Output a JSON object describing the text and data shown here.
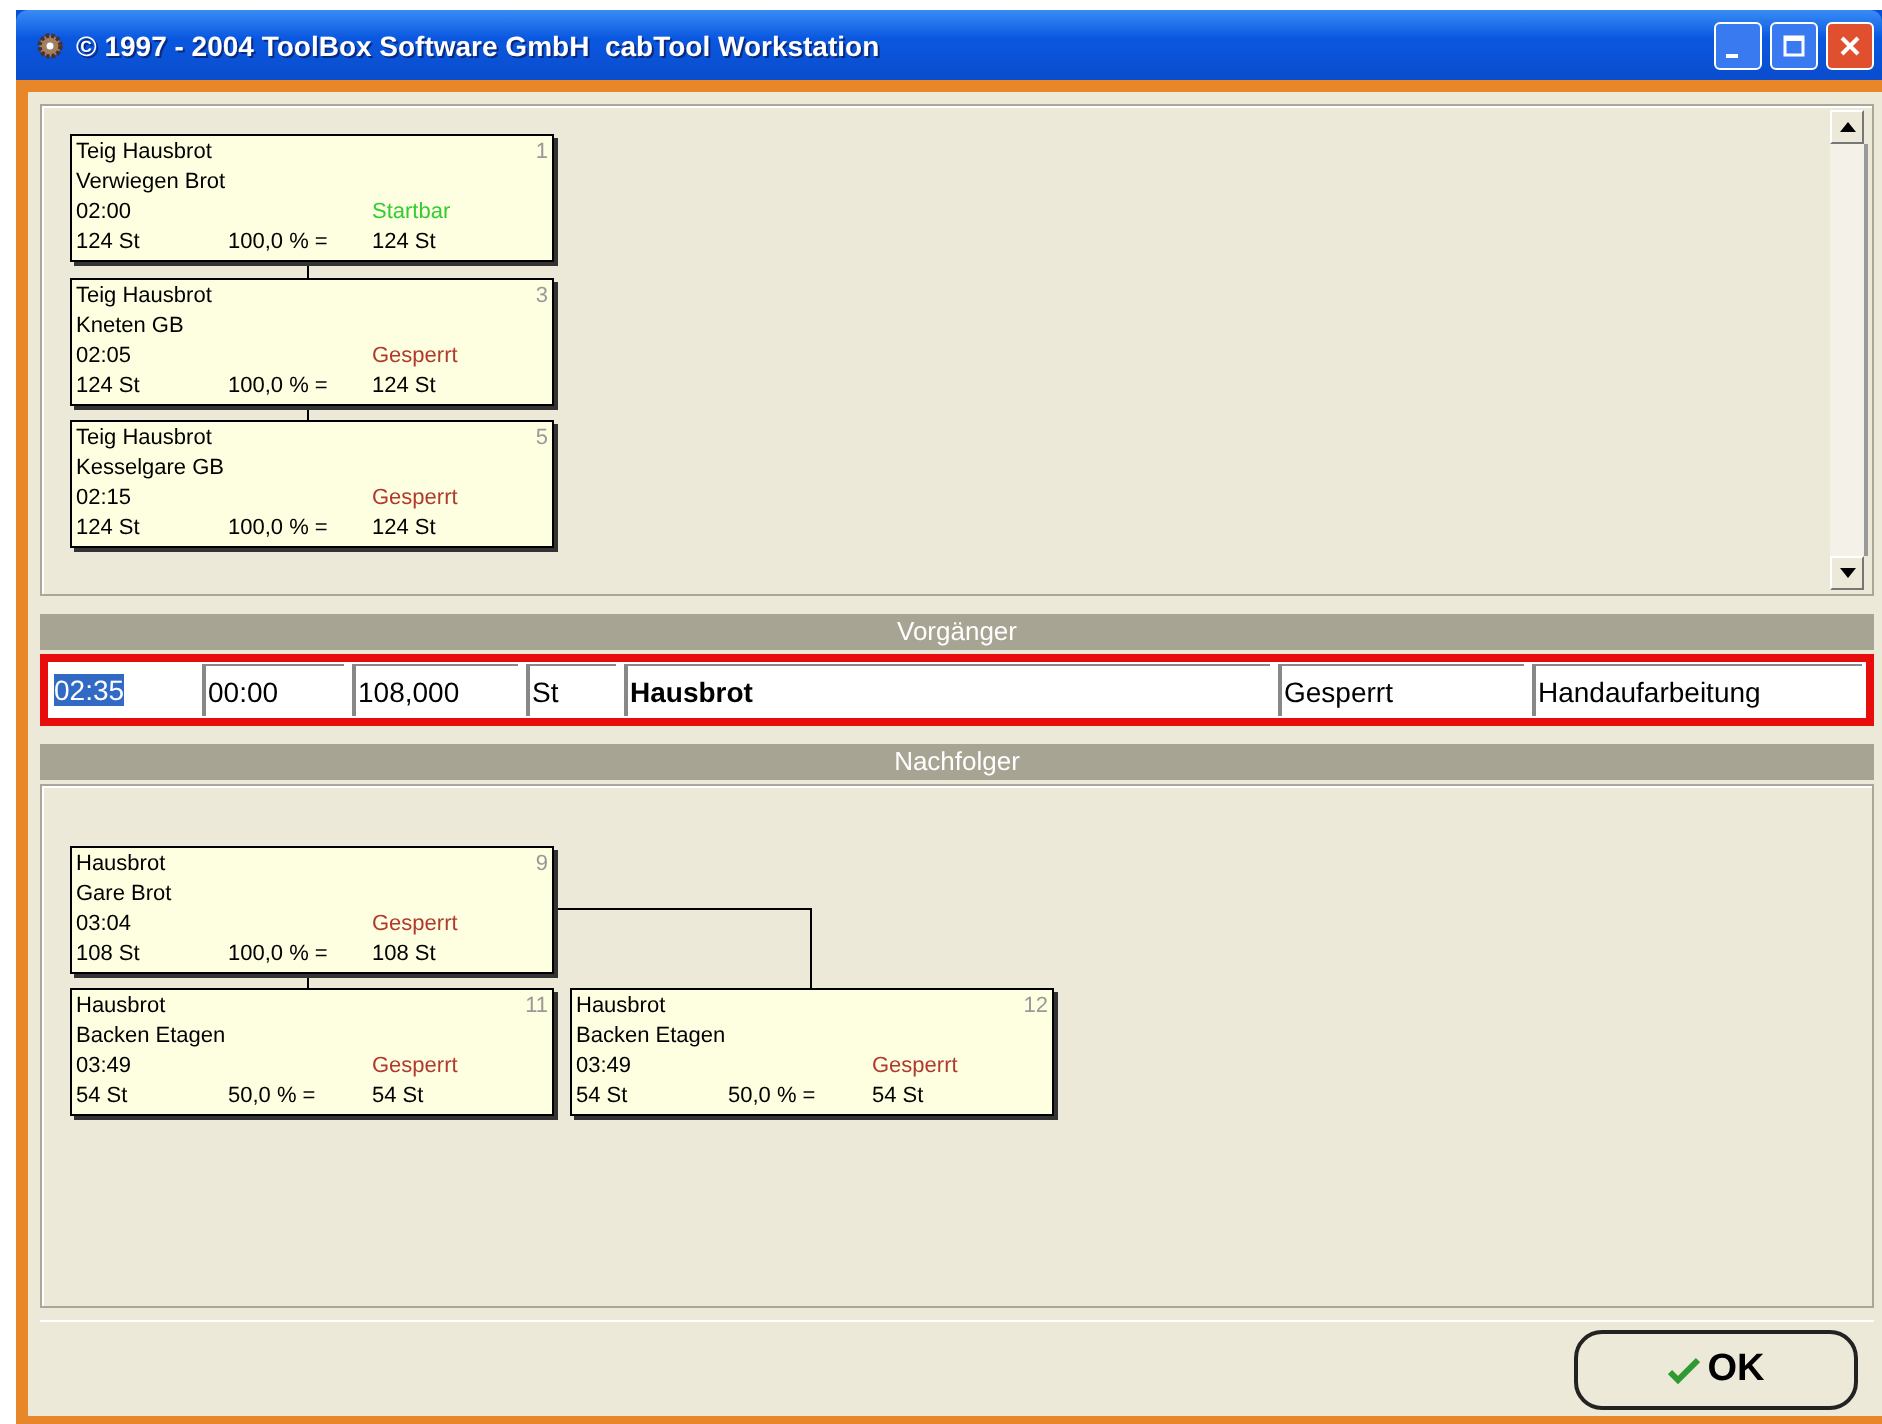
{
  "window": {
    "title": "© 1997 - 2004 ToolBox Software GmbH  cabTool Workstation"
  },
  "upper": {
    "cards": [
      {
        "number": "1",
        "product": "Teig Hausbrot",
        "step": "Verwiegen Brot",
        "time": "02:00",
        "status": "Startbar",
        "color": "#33cc33",
        "quantity": "124 St",
        "percent": "100,0 % =",
        "result": "124 St"
      },
      {
        "number": "3",
        "product": "Teig Hausbrot",
        "step": "Kneten GB",
        "time": "02:05",
        "status": "Gesperrt",
        "color": "#b03a2e",
        "quantity": "124 St",
        "percent": "100,0 % =",
        "result": "124 St"
      },
      {
        "number": "5",
        "product": "Teig Hausbrot",
        "step": "Kesselgare GB",
        "time": "02:15",
        "status": "Gesperrt",
        "color": "#b03a2e",
        "quantity": "124 St",
        "percent": "100,0 % =",
        "result": "124 St"
      }
    ]
  },
  "predecessor": {
    "title": "Vorgänger",
    "fields": [
      {
        "value": "02:35",
        "selected": true,
        "bold": false
      },
      {
        "value": "00:00",
        "selected": false,
        "bold": false
      },
      {
        "value": "108,000",
        "selected": false,
        "bold": false
      },
      {
        "value": "St",
        "selected": false,
        "bold": false
      },
      {
        "value": "Hausbrot",
        "selected": false,
        "bold": true
      },
      {
        "value": "Gesperrt",
        "selected": false,
        "bold": false
      },
      {
        "value": "Handaufarbeitung",
        "selected": false,
        "bold": false
      }
    ]
  },
  "successor": {
    "title": "Nachfolger",
    "cards": [
      {
        "number": "9",
        "product": "Hausbrot",
        "step": "Gare Brot",
        "time": "03:04",
        "status": "Gesperrt",
        "color": "#b03a2e",
        "quantity": "108 St",
        "percent": "100,0 % =",
        "result": "108 St"
      },
      {
        "number": "11",
        "product": "Hausbrot",
        "step": "Backen Etagen",
        "time": "03:49",
        "status": "Gesperrt",
        "color": "#b03a2e",
        "quantity": "54 St",
        "percent": "50,0 % =",
        "result": "54 St"
      },
      {
        "number": "12",
        "product": "Hausbrot",
        "step": "Backen Etagen",
        "time": "03:49",
        "status": "Gesperrt",
        "color": "#b03a2e",
        "quantity": "54 St",
        "percent": "50,0 % =",
        "result": "54 St"
      }
    ]
  },
  "buttons": [
    {
      "label": "OK"
    }
  ]
}
